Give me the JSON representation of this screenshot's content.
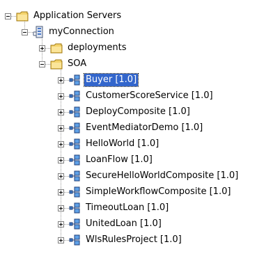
{
  "tree": {
    "root": {
      "label": "Application Servers"
    },
    "connection": {
      "label": "myConnection"
    },
    "deployments": {
      "label": "deployments"
    },
    "soa": {
      "label": "SOA",
      "composites": [
        {
          "label": "Buyer [1.0]",
          "selected": true
        },
        {
          "label": "CustomerScoreService [1.0]"
        },
        {
          "label": "DeployComposite [1.0]"
        },
        {
          "label": "EventMediatorDemo [1.0]"
        },
        {
          "label": "HelloWorld [1.0]"
        },
        {
          "label": "LoanFlow [1.0]"
        },
        {
          "label": "SecureHelloWorldComposite [1.0]"
        },
        {
          "label": "SimpleWorkflowComposite [1.0]"
        },
        {
          "label": "TimeoutLoan [1.0]"
        },
        {
          "label": "UnitedLoan [1.0]"
        },
        {
          "label": "WlsRulesProject [1.0]"
        }
      ]
    }
  },
  "colors": {
    "selection": "#3366cc",
    "folder": "#f4d36b",
    "composite": "#3c78c8"
  },
  "icons": {
    "root": "folder-icon",
    "connection": "server-connection-icon",
    "deployments": "folder-icon",
    "soa": "folder-icon",
    "composite": "composite-icon"
  }
}
